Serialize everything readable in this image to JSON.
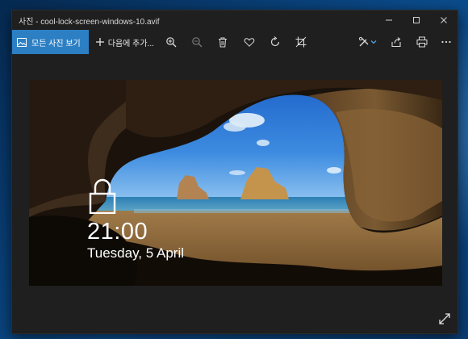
{
  "window": {
    "title": "사진 - cool-lock-screen-windows-10.avif"
  },
  "toolbar": {
    "all_photos_label": "모든 사진 보기",
    "add_to_label": "다음에 추가...",
    "icons": [
      "zoom-in-icon",
      "zoom-out-icon",
      "delete-icon",
      "favorite-heart-icon",
      "rotate-icon",
      "crop-icon",
      "edit-create-icon",
      "share-icon",
      "print-icon",
      "more-icon"
    ]
  },
  "photo": {
    "lock_time": "21:00",
    "lock_date": "Tuesday, 5 April"
  },
  "colors": {
    "accent": "#2d7fc4",
    "window_bg": "#1f1f1f"
  }
}
